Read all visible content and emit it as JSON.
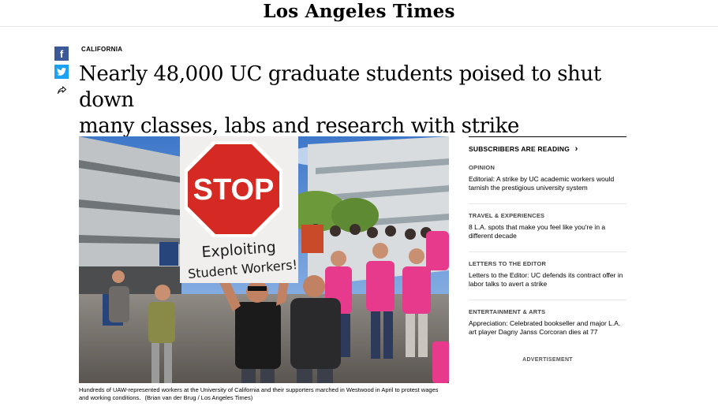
{
  "masthead": {
    "logo_text": "Los Angeles Times"
  },
  "share": {
    "facebook": "f"
  },
  "article": {
    "section": "CALIFORNIA",
    "headline_line1": "Nearly 48,000 UC graduate students poised to shut down",
    "headline_line2": "many classes, labs and research with strike",
    "image": {
      "sign_top": "STOP",
      "sign_line1": "Exploiting",
      "sign_line2": "Student Workers!"
    },
    "caption": "Hundreds of UAW-represented workers at the University of California and their supporters marched in Westwood in April to protest wages and working conditions.",
    "credit": "(Brian van der Brug / Los Angeles Times)"
  },
  "rail": {
    "header": "SUBSCRIBERS ARE READING",
    "header_arrow": "›",
    "items": [
      {
        "category": "OPINION",
        "title": "Editorial: A strike by UC academic workers would tarnish the prestigious university system"
      },
      {
        "category": "TRAVEL & EXPERIENCES",
        "title": "8 L.A. spots that make you feel like you're in a different decade"
      },
      {
        "category": "LETTERS TO THE EDITOR",
        "title": "Letters to the Editor: UC defends its contract offer in labor talks to avert a strike"
      },
      {
        "category": "ENTERTAINMENT & ARTS",
        "title": "Appreciation: Celebrated bookseller and major L.A. art player Dagny Janss Corcoran dies at 77"
      }
    ]
  },
  "advertisement_label": "ADVERTISEMENT",
  "colors": {
    "facebook": "#3b5998",
    "twitter": "#1da1f2",
    "shirt_pink": "#e83a8c",
    "stop_red": "#d42a23"
  }
}
